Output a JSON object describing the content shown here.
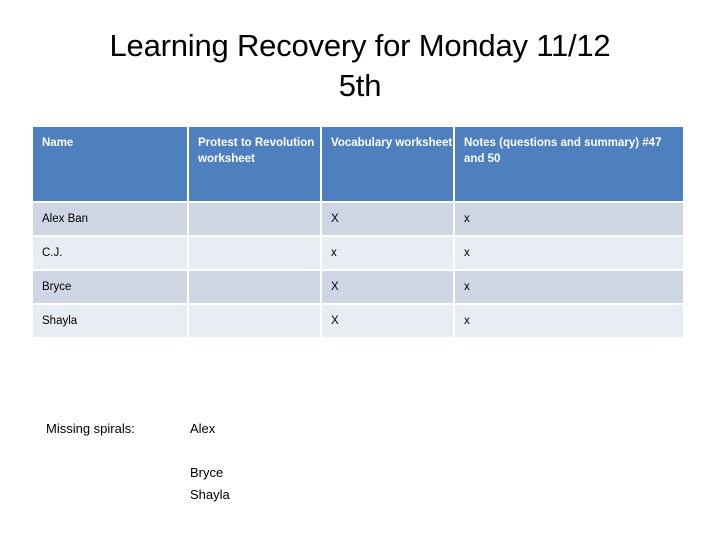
{
  "slide": {
    "title_lines": [
      "Learning Recovery for Monday 11/12",
      "5th"
    ]
  },
  "table": {
    "columns": [
      "Name",
      "Protest to Revolution worksheet",
      "Vocabulary worksheet",
      "Notes (questions and summary) #47 and 50"
    ],
    "rows": [
      {
        "name": "Alex Ban",
        "protest": "",
        "vocabulary": "X",
        "notes": "x"
      },
      {
        "name": "C.J.",
        "protest": "",
        "vocabulary": "x",
        "notes": "x"
      },
      {
        "name": "Bryce",
        "protest": "",
        "vocabulary": "X",
        "notes": "x"
      },
      {
        "name": "Shayla",
        "protest": "",
        "vocabulary": "X",
        "notes": "x"
      }
    ]
  },
  "missing_spirals": {
    "label": "Missing spirals:",
    "names": [
      "Alex",
      "Bryce",
      "Shayla"
    ]
  },
  "colors": {
    "header_blue": "#4E80BF",
    "row_shade": "#CED5E3",
    "row_plain": "#E8ECF3",
    "text": "#000000",
    "background": "#FFFFFF"
  }
}
